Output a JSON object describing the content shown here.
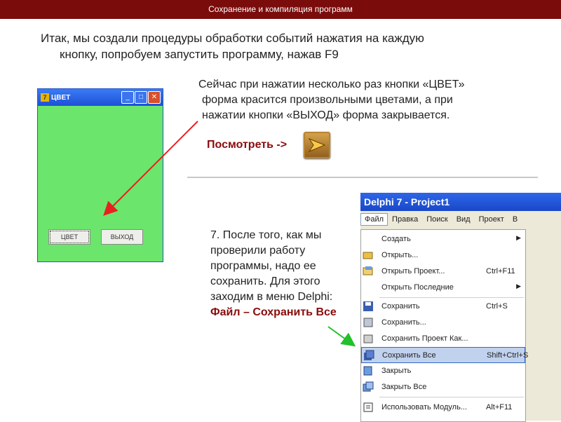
{
  "header": {
    "title": "Сохранение и компиляция программ"
  },
  "intro": {
    "line1": "Итак, мы создали процедуры обработки событий нажатия на каждую",
    "line2": "кнопку, попробуем запустить программу, нажав F9"
  },
  "description": {
    "line1": "Сейчас при нажатии несколько раз кнопки «ЦВЕТ»",
    "line2": "форма красится произвольными цветами, а при",
    "line3": "нажатии кнопки «ВЫХОД» форма закрывается."
  },
  "watch_label": "Посмотреть ->",
  "app_window": {
    "title": "ЦВЕТ",
    "color_button": "ЦВЕТ",
    "exit_button": "ВЫХОД",
    "form_color": "#6be56b"
  },
  "step": {
    "text": "7. После того, как мы проверили работу программы, надо ее сохранить. Для этого заходим в меню Delphi:",
    "highlight": "Файл – Сохранить Все"
  },
  "delphi": {
    "title": "Delphi 7 - Project1",
    "menubar": [
      "Файл",
      "Правка",
      "Поиск",
      "Вид",
      "Проект",
      "В"
    ],
    "menu_items": [
      {
        "label": "Создать",
        "shortcut": "",
        "arrow": "▶"
      },
      {
        "label": "Открыть...",
        "shortcut": "",
        "arrow": ""
      },
      {
        "label": "Открыть Проект...",
        "shortcut": "Ctrl+F11",
        "arrow": ""
      },
      {
        "label": "Открыть Последние",
        "shortcut": "",
        "arrow": "▶"
      },
      {
        "label": "Сохранить",
        "shortcut": "Ctrl+S",
        "arrow": ""
      },
      {
        "label": "Сохранить...",
        "shortcut": "",
        "arrow": ""
      },
      {
        "label": "Сохранить Проект Как...",
        "shortcut": "",
        "arrow": ""
      },
      {
        "label": "Сохранить Все",
        "shortcut": "Shift+Ctrl+S",
        "arrow": ""
      },
      {
        "label": "Закрыть",
        "shortcut": "",
        "arrow": ""
      },
      {
        "label": "Закрыть Все",
        "shortcut": "",
        "arrow": ""
      },
      {
        "label": "Использовать Модуль...",
        "shortcut": "Alt+F11",
        "arrow": ""
      }
    ]
  }
}
